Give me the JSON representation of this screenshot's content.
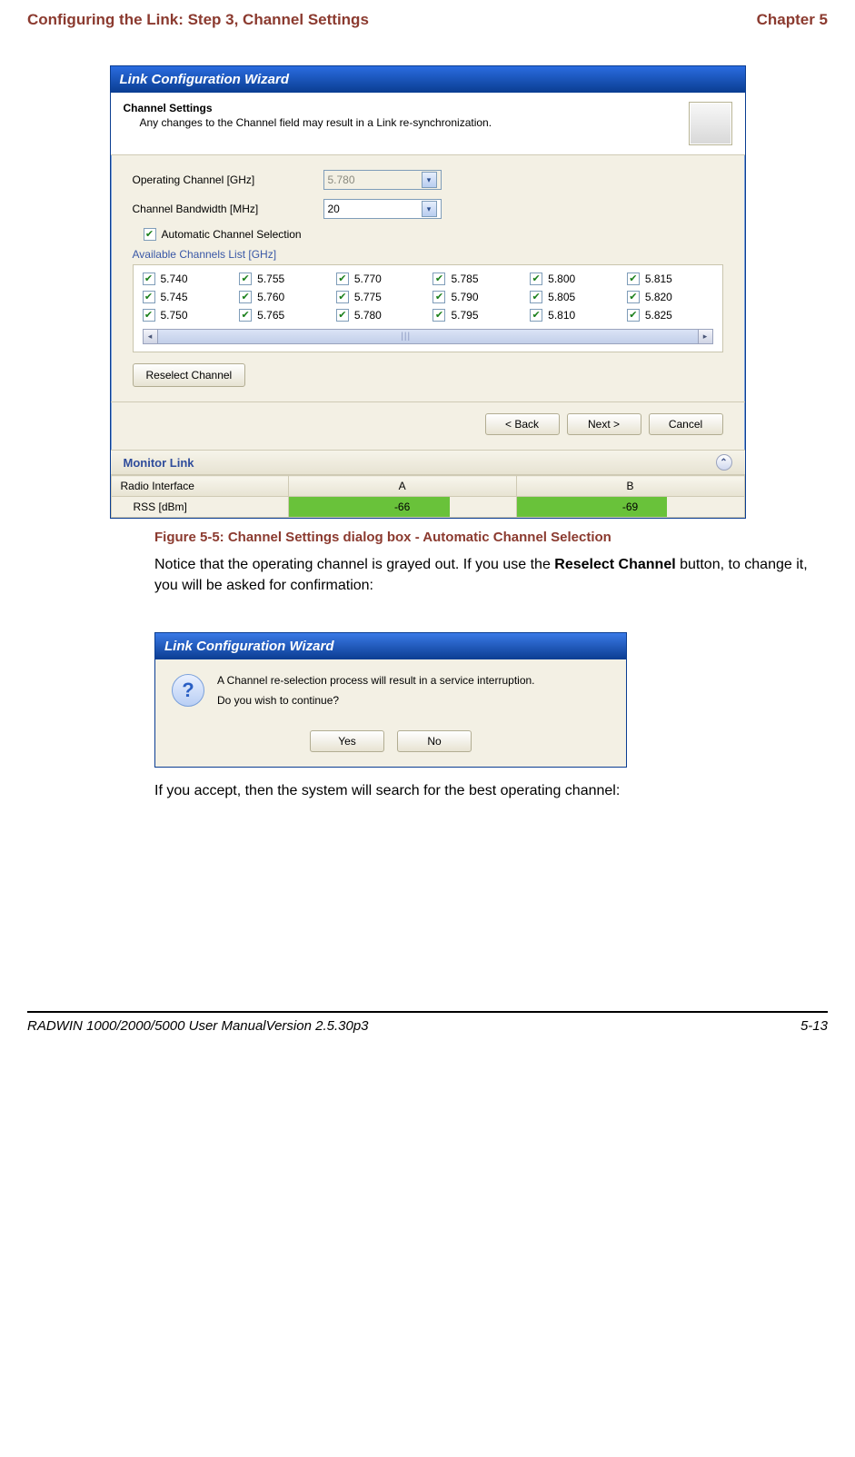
{
  "header": {
    "left": "Configuring the Link: Step 3, Channel Settings",
    "right": "Chapter 5"
  },
  "wizard1": {
    "title": "Link Configuration Wizard",
    "header_title": "Channel Settings",
    "header_sub": "Any changes to the Channel field may result in a Link re-synchronization.",
    "operating_label": "Operating Channel [GHz]",
    "operating_value": "5.780",
    "bandwidth_label": "Channel Bandwidth [MHz]",
    "bandwidth_value": "20",
    "acs_label": "Automatic Channel Selection",
    "group_label": "Available Channels List [GHz]",
    "channels": [
      "5.740",
      "5.755",
      "5.770",
      "5.785",
      "5.800",
      "5.815",
      "5.745",
      "5.760",
      "5.775",
      "5.790",
      "5.805",
      "5.820",
      "5.750",
      "5.765",
      "5.780",
      "5.795",
      "5.810",
      "5.825"
    ],
    "reselect_label": "Reselect Channel",
    "nav": {
      "back": "< Back",
      "next": "Next >",
      "cancel": "Cancel"
    },
    "monitor_title": "Monitor Link",
    "monitor": {
      "row0": "Radio Interface",
      "colA": "A",
      "colB": "B",
      "row1": "RSS [dBm]",
      "valA": "-66",
      "valB": "-69"
    }
  },
  "caption1": "Figure 5-5: Channel Settings dialog box - Automatic Channel Selection",
  "para1_pre": "Notice that the operating channel is grayed out. If you use the ",
  "para1_bold": "Reselect Channel",
  "para1_post": " button, to change it, you will be asked for confirmation:",
  "dialog2": {
    "title": "Link Configuration Wizard",
    "line1": "A Channel re-selection process will result in a service interruption.",
    "line2": "Do you wish to continue?",
    "yes": "Yes",
    "no": "No"
  },
  "para2": "If you accept, then the system will search for the best operating channel:",
  "footer": {
    "left": "RADWIN 1000/2000/5000 User ManualVersion  2.5.30p3",
    "right": "5-13"
  }
}
